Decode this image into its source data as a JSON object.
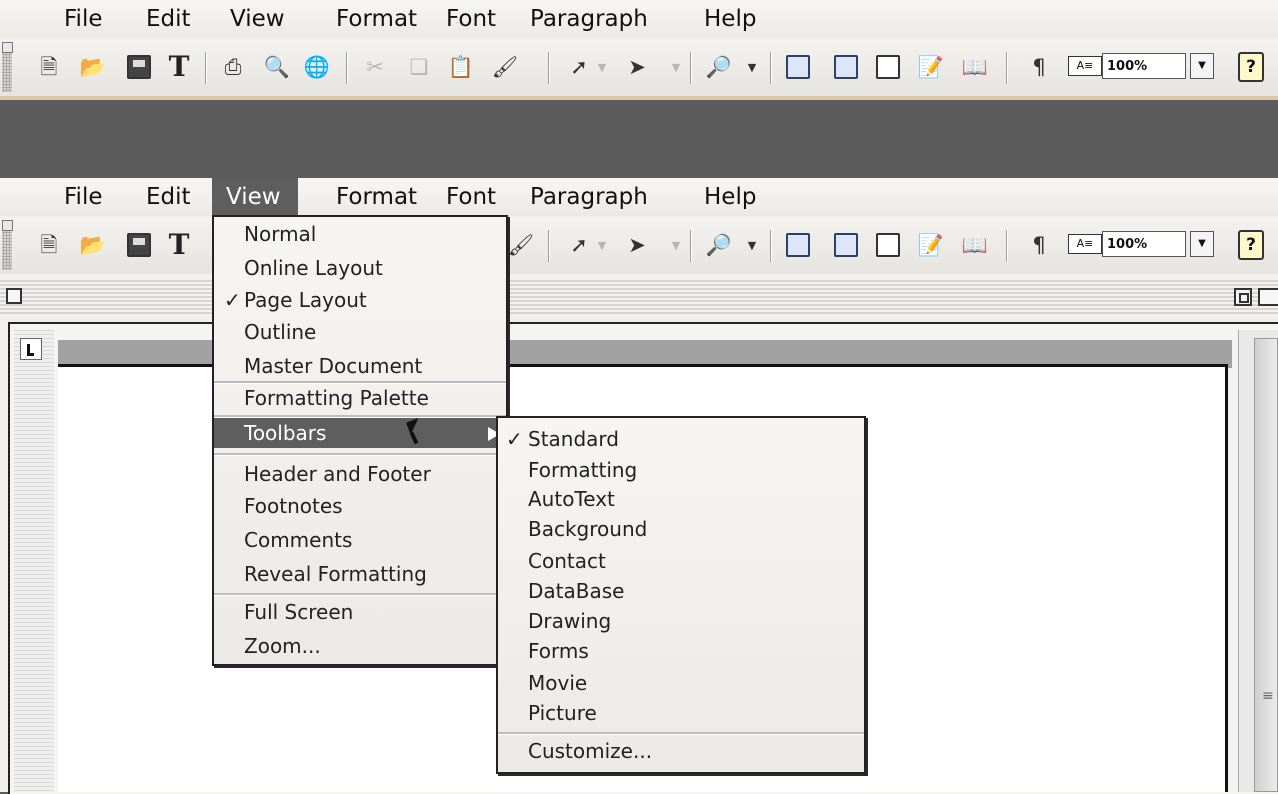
{
  "menubar": {
    "items": [
      "File",
      "Edit",
      "View",
      "Format",
      "Font",
      "Paragraph",
      "Help"
    ]
  },
  "toolbar": {
    "zoom": "100%",
    "icons": [
      "new-document-icon",
      "open-folder-icon",
      "save-icon",
      "text-tool-icon",
      "print-icon",
      "print-preview-icon",
      "web-globe-icon",
      "cut-icon",
      "copy-icon",
      "paste-icon",
      "format-painter-icon",
      "select-arrow-icon",
      "move-arrow-icon",
      "zoom-magnifier-icon",
      "draw-table-icon",
      "tables-icon",
      "columns-icon",
      "drawing-icon",
      "navigation-icon",
      "paragraph-mark-icon",
      "text-box-icon",
      "help-icon"
    ]
  },
  "view_menu": {
    "items": [
      {
        "label": "Normal",
        "checked": false
      },
      {
        "label": "Online Layout",
        "checked": false
      },
      {
        "label": "Page Layout",
        "checked": true
      },
      {
        "label": "Outline",
        "checked": false
      },
      {
        "label": "Master Document",
        "checked": false
      },
      {
        "label": "Formatting Palette",
        "checked": false
      },
      {
        "label": "Toolbars",
        "checked": false,
        "submenu": true,
        "highlighted": true
      },
      {
        "label": "Header and Footer",
        "checked": false
      },
      {
        "label": "Footnotes",
        "checked": false
      },
      {
        "label": "Comments",
        "checked": false
      },
      {
        "label": "Reveal Formatting",
        "checked": false
      },
      {
        "label": "Full Screen",
        "checked": false
      },
      {
        "label": "Zoom...",
        "checked": false
      }
    ]
  },
  "toolbars_submenu": {
    "items": [
      {
        "label": "Standard",
        "checked": true
      },
      {
        "label": "Formatting",
        "checked": false
      },
      {
        "label": "AutoText",
        "checked": false
      },
      {
        "label": "Background",
        "checked": false
      },
      {
        "label": "Contact",
        "checked": false
      },
      {
        "label": "DataBase",
        "checked": false
      },
      {
        "label": "Drawing",
        "checked": false
      },
      {
        "label": "Forms",
        "checked": false
      },
      {
        "label": "Movie",
        "checked": false
      },
      {
        "label": "Picture",
        "checked": false
      },
      {
        "label": "Customize...",
        "checked": false
      }
    ]
  },
  "colors": {
    "menu_highlight": "#5e5e5e",
    "background_gap": "#5b5b5b"
  }
}
